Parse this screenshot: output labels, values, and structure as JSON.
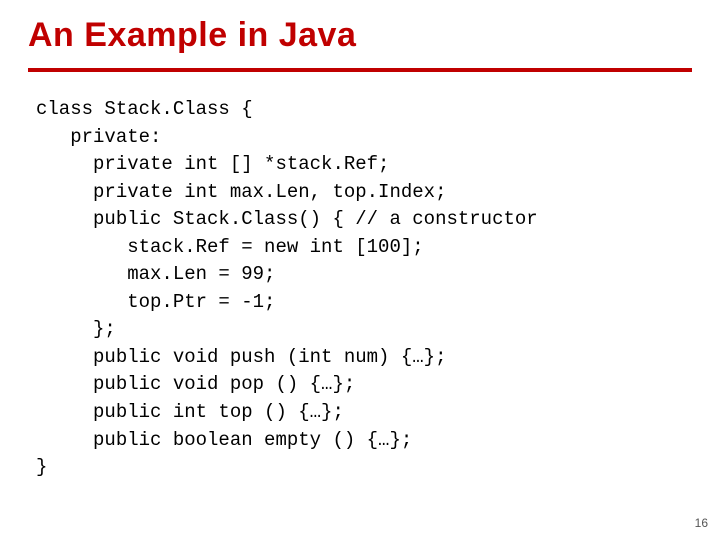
{
  "title": "An Example in Java",
  "code_lines": [
    "class Stack.Class {",
    "   private:",
    "     private int [] *stack.Ref;",
    "     private int max.Len, top.Index;",
    "     public Stack.Class() { // a constructor",
    "        stack.Ref = new int [100];",
    "        max.Len = 99;",
    "        top.Ptr = -1;",
    "     };",
    "     public void push (int num) {…};",
    "     public void pop () {…};",
    "     public int top () {…};",
    "     public boolean empty () {…};",
    "}"
  ],
  "page_number": "16"
}
